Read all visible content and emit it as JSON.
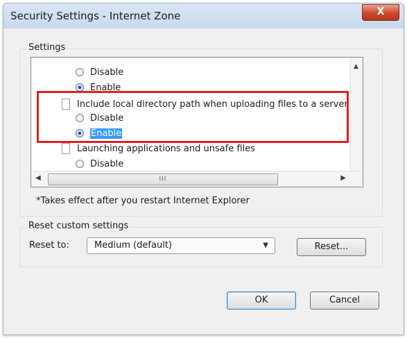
{
  "window": {
    "title": "Security Settings - Internet Zone",
    "close_label": "X"
  },
  "settings": {
    "group_label": "Settings",
    "rows": [
      {
        "kind": "radio",
        "label": "Disable",
        "checked": false
      },
      {
        "kind": "radio",
        "label": "Enable",
        "checked": true
      },
      {
        "kind": "header",
        "label": "Include local directory path when uploading files to a server"
      },
      {
        "kind": "radio",
        "label": "Disable",
        "checked": false
      },
      {
        "kind": "radio",
        "label": "Enable",
        "checked": true,
        "selected": true
      },
      {
        "kind": "header",
        "label": "Launching applications and unsafe files"
      },
      {
        "kind": "radio",
        "label": "Disable",
        "checked": false
      }
    ],
    "hscroll_thumb_grip": "III",
    "note": "*Takes effect after you restart Internet Explorer"
  },
  "reset": {
    "group_label": "Reset custom settings",
    "reset_to_label": "Reset to:",
    "combo_value": "Medium (default)",
    "reset_button": "Reset..."
  },
  "buttons": {
    "ok": "OK",
    "cancel": "Cancel"
  },
  "colors": {
    "highlight_box": "#e02020",
    "selection": "#3399ff",
    "close_button": "#c9482c"
  }
}
